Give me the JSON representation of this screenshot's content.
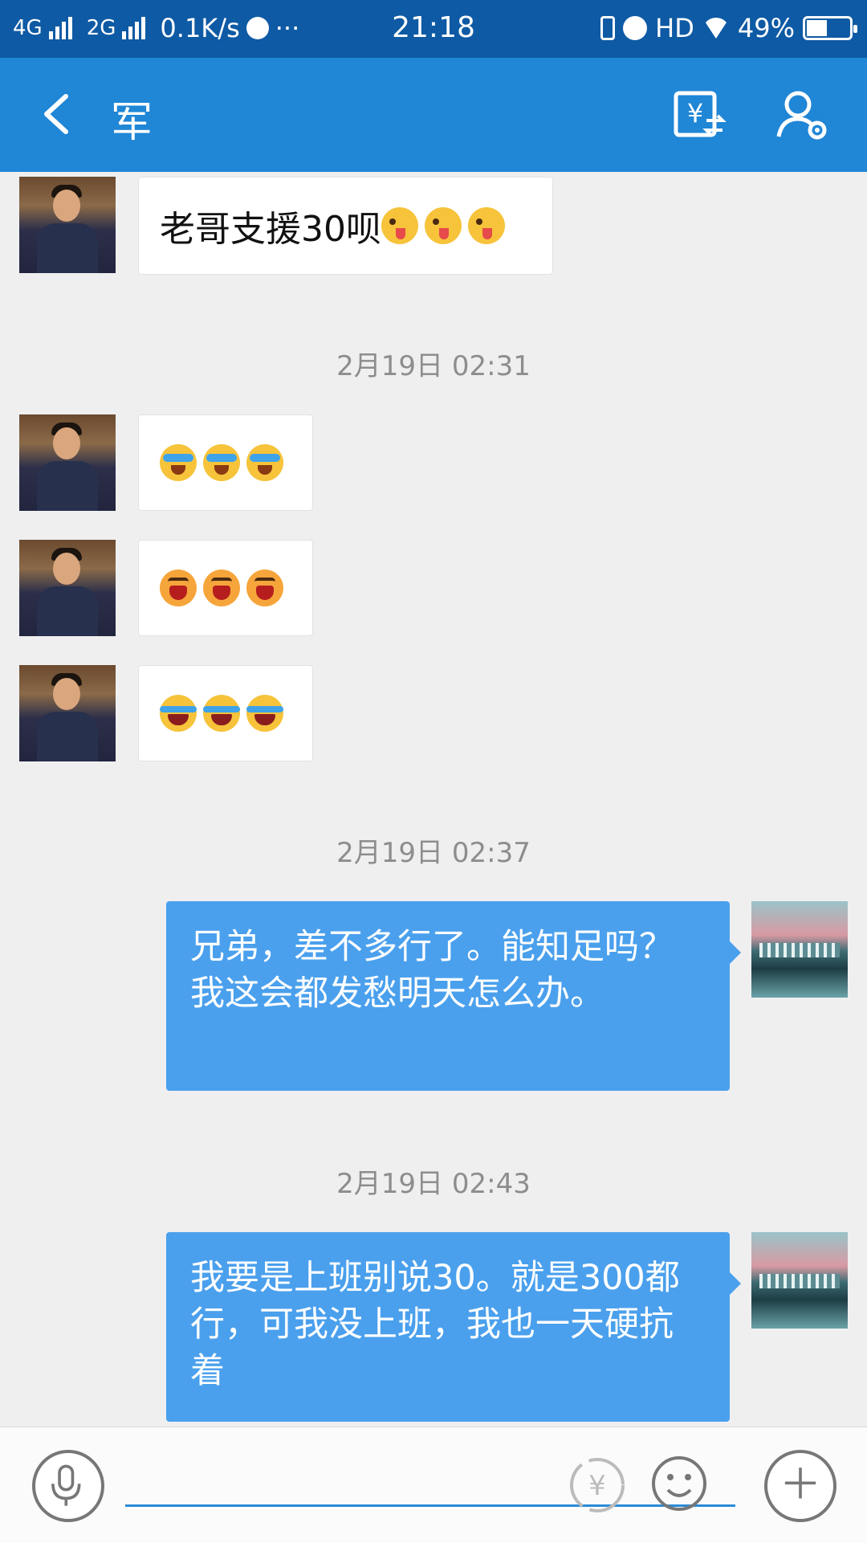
{
  "status_bar": {
    "net1": "4G",
    "net2": "2G",
    "speed": "0.1K/s",
    "more": "···",
    "time": "21:18",
    "hd": "HD",
    "battery_text": "49%",
    "battery_level": 0.49
  },
  "header": {
    "title": "军",
    "back_icon": "back-chevron-icon",
    "transfer_icon": "money-transfer-icon",
    "settings_icon": "user-settings-icon"
  },
  "messages": {
    "m1": {
      "text": "老哥支援30呗",
      "emojis": [
        "tongue",
        "tongue",
        "tongue"
      ]
    },
    "ts1": "2月19日 02:31",
    "m2": {
      "emojis": [
        "cry",
        "cry",
        "cry"
      ]
    },
    "m3": {
      "emojis": [
        "laugh",
        "laugh",
        "laugh"
      ]
    },
    "m4": {
      "emojis": [
        "joy",
        "joy",
        "joy"
      ]
    },
    "ts2": "2月19日 02:37",
    "m5": {
      "text": "兄弟，差不多行了。能知足吗？我这会都发愁明天怎么办。"
    },
    "ts3": "2月19日 02:43",
    "m6": {
      "text": "我要是上班别说30。就是300都行，可我没上班，我也一天硬抗着"
    }
  },
  "input_bar": {
    "voice_icon": "microphone-icon",
    "red_packet_icon": "yuan-icon",
    "emoji_icon": "smiley-icon",
    "plus_icon": "plus-icon",
    "placeholder": ""
  },
  "colors": {
    "status_bar": "#0e5aa4",
    "header": "#2086d6",
    "outgoing_bubble": "#4aa0ed",
    "incoming_bubble": "#ffffff",
    "background": "#efeff0"
  }
}
